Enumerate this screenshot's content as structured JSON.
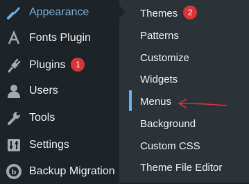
{
  "sidebar": {
    "items": [
      {
        "label": "Appearance",
        "icon": "paintbrush-icon",
        "current": true
      },
      {
        "label": "Fonts Plugin",
        "icon": "letter-a-icon"
      },
      {
        "label": "Plugins",
        "icon": "plug-icon",
        "badge": "1"
      },
      {
        "label": "Users",
        "icon": "user-icon"
      },
      {
        "label": "Tools",
        "icon": "wrench-icon"
      },
      {
        "label": "Settings",
        "icon": "sliders-icon"
      },
      {
        "label": "Backup Migration",
        "icon": "backup-migration-icon"
      }
    ]
  },
  "submenu": {
    "items": [
      {
        "label": "Themes",
        "badge": "2"
      },
      {
        "label": "Patterns"
      },
      {
        "label": "Customize"
      },
      {
        "label": "Widgets"
      },
      {
        "label": "Menus",
        "highlighted": true
      },
      {
        "label": "Background"
      },
      {
        "label": "Custom CSS"
      },
      {
        "label": "Theme File Editor"
      }
    ]
  },
  "colors": {
    "sidebar_bg": "#1d2327",
    "submenu_bg": "#2c3338",
    "accent": "#72aee6",
    "badge": "#d63638",
    "annotation_arrow": "#d63638"
  }
}
